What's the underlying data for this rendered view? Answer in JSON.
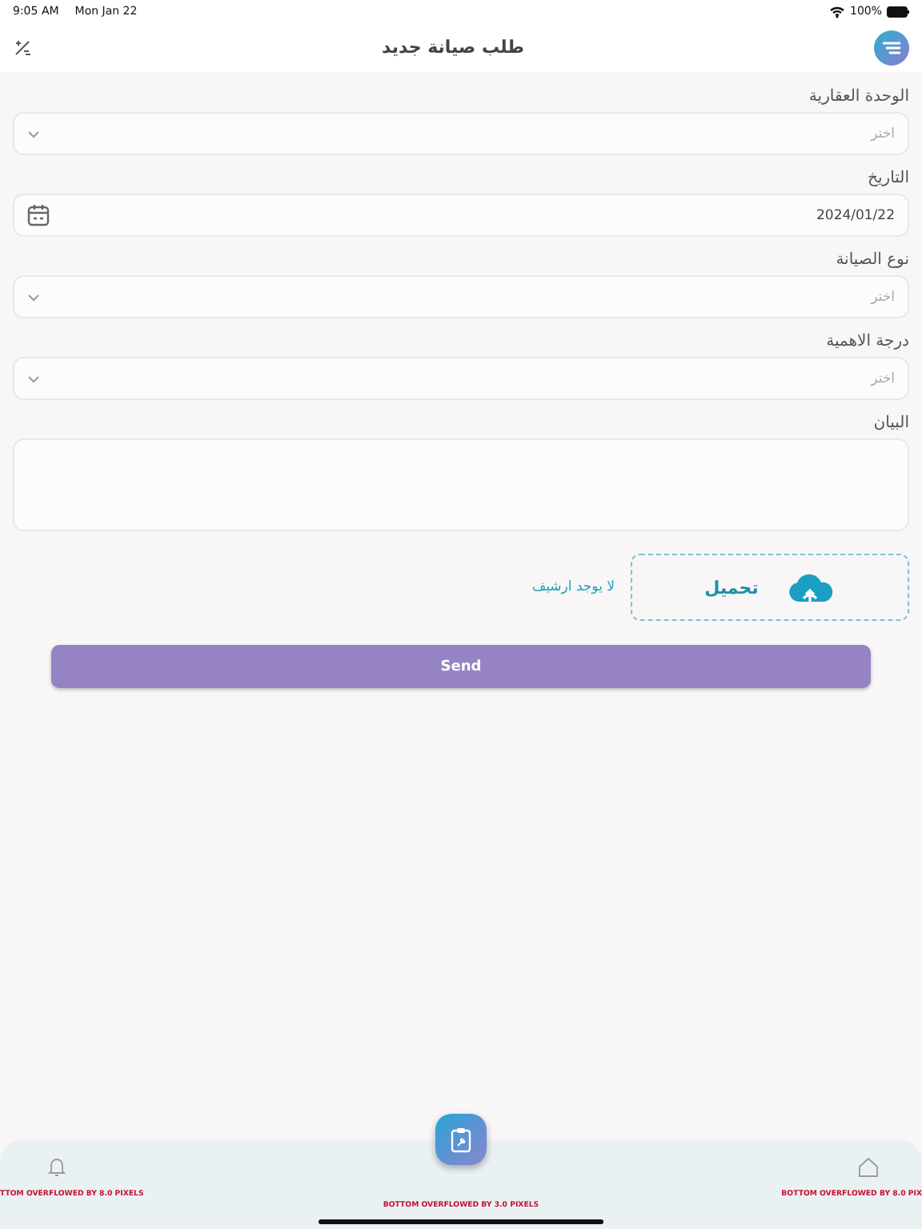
{
  "status_bar": {
    "time": "9:05 AM",
    "date": "Mon Jan 22",
    "battery": "100%"
  },
  "header": {
    "title": "طلب صيانة جديد"
  },
  "fields": [
    {
      "kind": "select",
      "label": "الوحدة العقارية",
      "placeholder": "اختر"
    },
    {
      "kind": "date",
      "label": "التاريخ",
      "value": "2024/01/22"
    },
    {
      "kind": "select",
      "label": "نوع الصيانة",
      "placeholder": "اختر"
    },
    {
      "kind": "select",
      "label": "درجة الاهمية",
      "placeholder": "اختر"
    },
    {
      "kind": "textarea",
      "label": "البيان"
    }
  ],
  "upload": {
    "button": "تحميل",
    "status": "لا يوجد ارشيف"
  },
  "submit": "Send",
  "bottom_nav": [
    {
      "kind": "bell",
      "error": "TTOM OVERFLOWED BY 8.0 PIXELS"
    },
    {
      "kind": "center",
      "error": "BOTTOM OVERFLOWED BY 3.0 PIXELS"
    },
    {
      "kind": "home",
      "error": "BOTTOM OVERFLOWED BY 8.0 PIX"
    }
  ]
}
